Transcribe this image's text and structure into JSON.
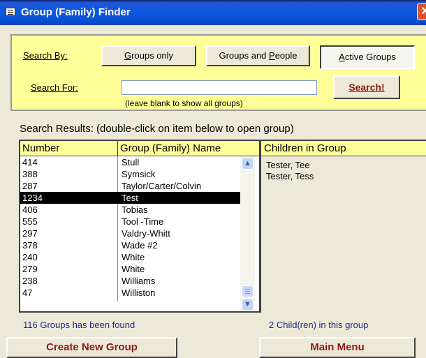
{
  "window": {
    "title": "Group (Family) Finder",
    "close_glyph": "✕"
  },
  "search": {
    "search_by_label": "Search By:",
    "search_for_label": "Search For:",
    "buttons": [
      {
        "label_pre": "",
        "label_u": "G",
        "label_post": "roups only"
      },
      {
        "label_pre": "Groups and ",
        "label_u": "P",
        "label_post": "eople"
      },
      {
        "label_pre": "",
        "label_u": "A",
        "label_post": "ctive Groups"
      }
    ],
    "input_value": "",
    "hint": "(leave blank to show all groups)",
    "search_button": "Search!"
  },
  "results": {
    "caption": "Search Results: (double-click on item below to open group)",
    "headers": {
      "number": "Number",
      "name": "Group (Family) Name",
      "children": "Children in Group"
    },
    "rows": [
      {
        "number": "414",
        "name": "Stull"
      },
      {
        "number": "388",
        "name": "Symsick"
      },
      {
        "number": "287",
        "name": "Taylor/Carter/Colvin"
      },
      {
        "number": "1234",
        "name": "Test"
      },
      {
        "number": "406",
        "name": "Tobias"
      },
      {
        "number": "555",
        "name": "Tool -Time"
      },
      {
        "number": "297",
        "name": "Valdry-Whitt"
      },
      {
        "number": "378",
        "name": "Wade #2"
      },
      {
        "number": "240",
        "name": "White"
      },
      {
        "number": "279",
        "name": "White"
      },
      {
        "number": "238",
        "name": "Williams"
      },
      {
        "number": "47",
        "name": "Williston"
      }
    ],
    "selected_index": 3,
    "children": [
      "Tester, Tee",
      "Tester, Tess"
    ]
  },
  "status": {
    "groups_found": "116  Groups has been found",
    "children_count": "2  Child(ren) in this group"
  },
  "actions": {
    "create_group": "Create New Group",
    "main_menu": "Main Menu"
  }
}
